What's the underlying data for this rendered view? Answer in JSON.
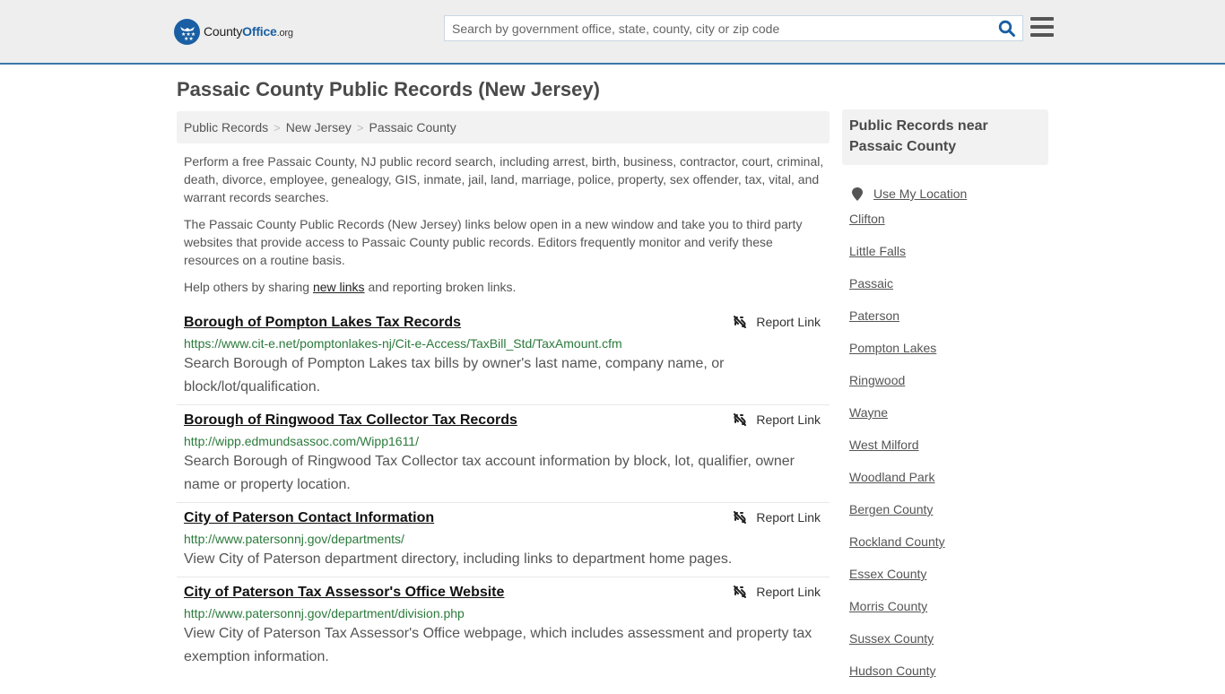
{
  "header": {
    "logo": {
      "brand_main": "County",
      "brand_accent": "Office",
      "brand_tld": ".org"
    },
    "search": {
      "placeholder": "Search by government office, state, county, city or zip code",
      "value": ""
    },
    "search_icon": "search-icon",
    "menu_icon": "hamburger-menu-icon"
  },
  "page": {
    "title": "Passaic County Public Records (New Jersey)",
    "breadcrumb": [
      "Public Records",
      "New Jersey",
      "Passaic County"
    ],
    "breadcrumb_separator": ">",
    "intro": {
      "p1": "Perform a free Passaic County, NJ public record search, including arrest, birth, business, contractor, court, criminal, death, divorce, employee, genealogy, GIS, inmate, jail, land, marriage, police, property, sex offender, tax, vital, and warrant records searches.",
      "p2": "The Passaic County Public Records (New Jersey) links below open in a new window and take you to third party websites that provide access to Passaic County public records. Editors frequently monitor and verify these resources on a routine basis.",
      "p3_before": "Help others by sharing ",
      "p3_link": "new links",
      "p3_after": " and reporting broken links."
    }
  },
  "records": [
    {
      "title": "Borough of Pompton Lakes Tax Records",
      "url": "https://www.cit-e.net/pomptonlakes-nj/Cit-e-Access/TaxBill_Std/TaxAmount.cfm",
      "description": "Search Borough of Pompton Lakes tax bills by owner's last name, company name, or block/lot/qualification.",
      "report_label": "Report Link"
    },
    {
      "title": "Borough of Ringwood Tax Collector Tax Records",
      "url": "http://wipp.edmundsassoc.com/Wipp1611/",
      "description": "Search Borough of Ringwood Tax Collector tax account information by block, lot, qualifier, owner name or property location.",
      "report_label": "Report Link"
    },
    {
      "title": "City of Paterson Contact Information",
      "url": "http://www.patersonnj.gov/departments/",
      "description": "View City of Paterson department directory, including links to department home pages.",
      "report_label": "Report Link"
    },
    {
      "title": "City of Paterson Tax Assessor's Office Website",
      "url": "http://www.patersonnj.gov/department/division.php",
      "description": "View City of Paterson Tax Assessor's Office webpage, which includes assessment and property tax exemption information.",
      "report_label": "Report Link"
    }
  ],
  "sidebar": {
    "title": "Public Records near Passaic County",
    "use_location": "Use My Location",
    "links": [
      "Clifton",
      "Little Falls",
      "Passaic",
      "Paterson",
      "Pompton Lakes",
      "Ringwood",
      "Wayne",
      "West Milford",
      "Woodland Park",
      "Bergen County",
      "Rockland County",
      "Essex County",
      "Morris County",
      "Sussex County",
      "Hudson County"
    ]
  },
  "colors": {
    "brand_blue": "#1a5fa3",
    "header_border": "#3b76a8",
    "url_green": "#2b7a3b"
  }
}
